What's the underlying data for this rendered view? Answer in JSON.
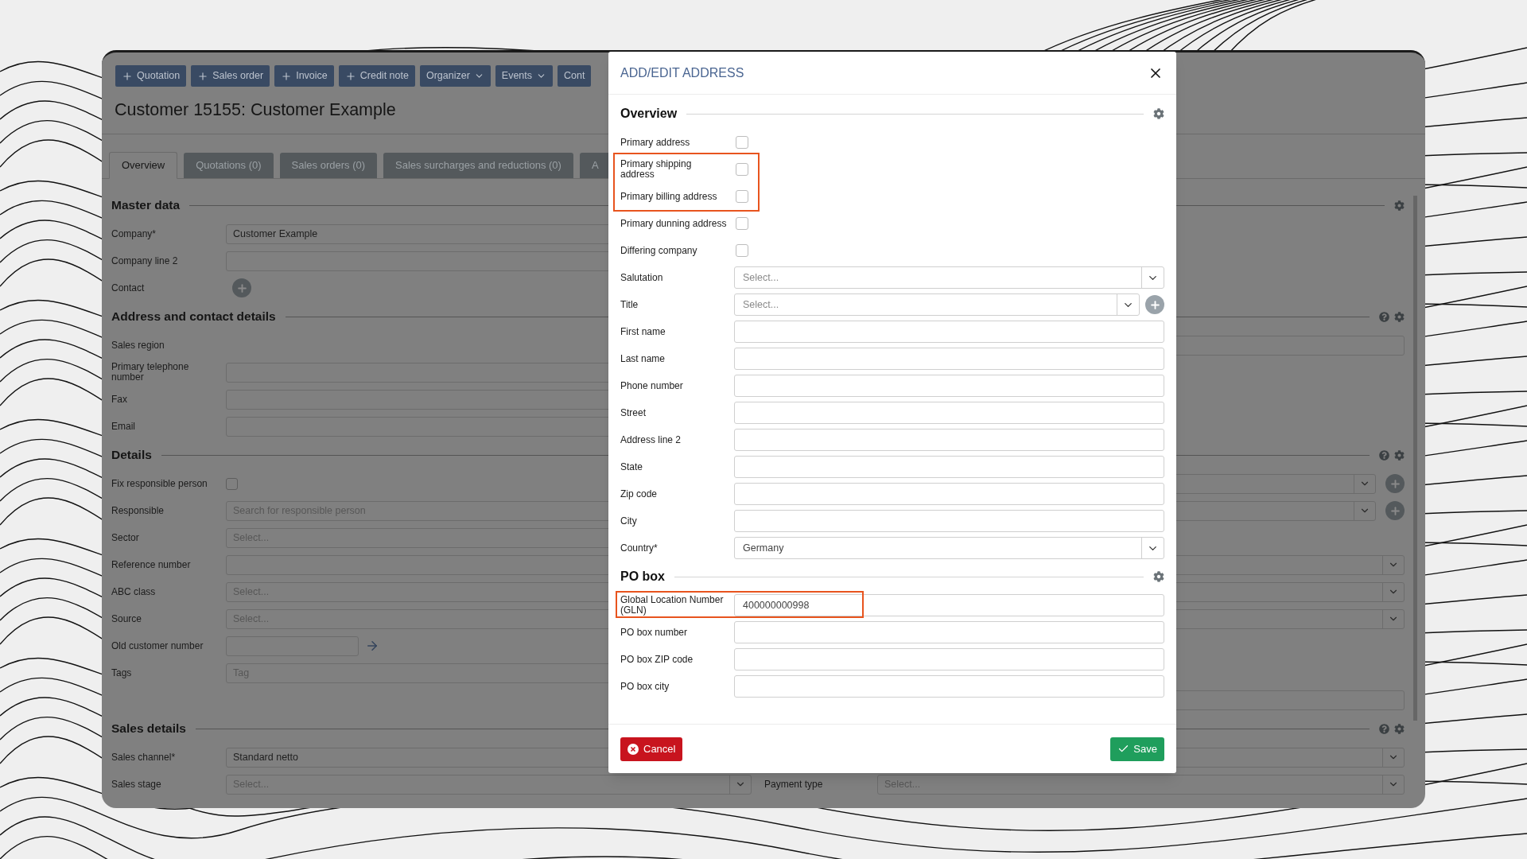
{
  "toolbar": [
    {
      "label": "Quotation",
      "kind": "add"
    },
    {
      "label": "Sales order",
      "kind": "add"
    },
    {
      "label": "Invoice",
      "kind": "add"
    },
    {
      "label": "Credit note",
      "kind": "add"
    },
    {
      "label": "Organizer",
      "kind": "menu"
    },
    {
      "label": "Events",
      "kind": "menu"
    },
    {
      "label": "Cont",
      "kind": "plain"
    }
  ],
  "title": "Customer 15155: Customer Example",
  "tabs": [
    {
      "label": "Overview",
      "selected": true
    },
    {
      "label": "Quotations (0)",
      "selected": false
    },
    {
      "label": "Sales orders (0)",
      "selected": false
    },
    {
      "label": "Sales surcharges and reductions (0)",
      "selected": false
    },
    {
      "label": "A",
      "selected": false
    }
  ],
  "sections": [
    {
      "title": "Master data",
      "help": false,
      "settings": true,
      "left": [
        {
          "label": "Company*",
          "kind": "input",
          "value": "Customer Example"
        },
        {
          "label": "Company line 2",
          "kind": "input"
        },
        {
          "label": "Contact",
          "kind": "add"
        }
      ]
    },
    {
      "title": "Address and contact details",
      "help": true,
      "settings": true,
      "left": [
        {
          "label": "Sales region",
          "kind": "none"
        },
        {
          "label": "Primary telephone number",
          "kind": "input"
        },
        {
          "label": "Fax",
          "kind": "input"
        },
        {
          "label": "Email",
          "kind": "input"
        }
      ],
      "right": [
        {
          "kind": "input"
        }
      ]
    },
    {
      "title": "Details",
      "help": true,
      "settings": true,
      "left": [
        {
          "label": "Fix responsible person",
          "kind": "checkbox",
          "checked": false
        },
        {
          "label": "Responsible",
          "kind": "input",
          "placeholder": "Search for responsible person"
        },
        {
          "label": "Sector",
          "kind": "select",
          "placeholder": "Select..."
        },
        {
          "label": "Reference number",
          "kind": "input"
        },
        {
          "label": "ABC class",
          "kind": "select",
          "placeholder": "Select..."
        },
        {
          "label": "Source",
          "kind": "select",
          "placeholder": "Select..."
        },
        {
          "label": "Old customer number",
          "kind": "link_input"
        },
        {
          "label": "Tags",
          "kind": "input",
          "placeholder": "Tag"
        }
      ],
      "right": [
        {
          "kind": "select_add"
        },
        {
          "kind": "select_add"
        },
        {
          "kind": "blank"
        },
        {
          "kind": "select"
        },
        {
          "kind": "select"
        },
        {
          "kind": "select"
        },
        {
          "kind": "blank"
        },
        {
          "kind": "blank"
        },
        {
          "kind": "input"
        }
      ]
    },
    {
      "title": "Sales details",
      "help": true,
      "settings": true,
      "left": [
        {
          "label": "Sales channel*",
          "kind": "select",
          "value": "Standard netto"
        },
        {
          "label": "Sales stage",
          "kind": "select",
          "placeholder": "Select..."
        }
      ],
      "right": [
        {
          "kind": "select"
        },
        {
          "kind": "select",
          "label": "Payment type",
          "placeholder": "Select..."
        }
      ]
    }
  ],
  "modal": {
    "title": "ADD/EDIT ADDRESS",
    "sections": [
      {
        "title": "Overview",
        "rows": [
          {
            "label": "Primary address",
            "kind": "checkbox",
            "checked": false,
            "highlighted": false
          },
          {
            "label": "Primary shipping address",
            "kind": "checkbox",
            "checked": false,
            "highlighted": true
          },
          {
            "label": "Primary billing address",
            "kind": "checkbox",
            "checked": false,
            "highlighted": true
          },
          {
            "label": "Primary dunning address",
            "kind": "checkbox",
            "checked": false,
            "highlighted": false
          },
          {
            "label": "Differing company",
            "kind": "checkbox",
            "checked": false,
            "highlighted": false
          },
          {
            "label": "Salutation",
            "kind": "select",
            "placeholder": "Select...",
            "highlighted": false
          },
          {
            "label": "Title",
            "kind": "select_add",
            "placeholder": "Select...",
            "highlighted": false
          },
          {
            "label": "First name",
            "kind": "input",
            "highlighted": false
          },
          {
            "label": "Last name",
            "kind": "input",
            "highlighted": false
          },
          {
            "label": "Phone number",
            "kind": "input",
            "highlighted": false
          },
          {
            "label": "Street",
            "kind": "input",
            "highlighted": false
          },
          {
            "label": "Address line 2",
            "kind": "input",
            "highlighted": false
          },
          {
            "label": "State",
            "kind": "input",
            "highlighted": false
          },
          {
            "label": "Zip code",
            "kind": "input",
            "highlighted": false
          },
          {
            "label": "City",
            "kind": "input",
            "highlighted": false
          },
          {
            "label": "Country*",
            "kind": "select",
            "value": "Germany",
            "highlighted": false
          }
        ]
      },
      {
        "title": "PO box",
        "rows": [
          {
            "label": "Global Location Number (GLN)",
            "kind": "input",
            "value": "400000000998",
            "highlighted": true
          },
          {
            "label": "PO box number",
            "kind": "input",
            "highlighted": false
          },
          {
            "label": "PO box ZIP code",
            "kind": "input",
            "highlighted": false
          },
          {
            "label": "PO box city",
            "kind": "input",
            "highlighted": false
          }
        ]
      }
    ],
    "buttons": [
      {
        "label": "Cancel",
        "kind": "cancel"
      },
      {
        "label": "Save",
        "kind": "save"
      }
    ]
  }
}
